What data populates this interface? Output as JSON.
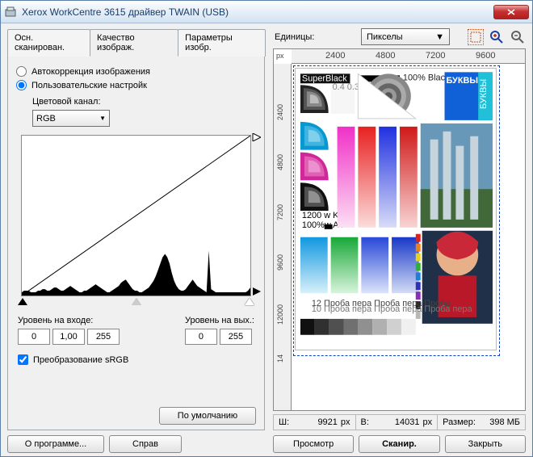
{
  "window": {
    "title": "Xerox WorkCentre 3615 драйвер TWAIN (USB)"
  },
  "tabs": {
    "t0": "Осн. сканирован.",
    "t1": "Качество изображ.",
    "t2": "Параметры изобр."
  },
  "correction": {
    "auto": "Автокоррекция изображения",
    "custom": "Пользовательские настройк",
    "channel_label": "Цветовой канал:",
    "channel_value": "RGB"
  },
  "levels": {
    "in_label": "Уровень на входе:",
    "out_label": "Уровень на вых.:",
    "in_low": "0",
    "in_gamma": "1,00",
    "in_high": "255",
    "out_low": "0",
    "out_high": "255"
  },
  "srgb": {
    "label": "Преобразование sRGB"
  },
  "buttons": {
    "defaults": "По умолчанию",
    "about": "О программе...",
    "help": "Справ",
    "preview": "Просмотр",
    "scan": "Сканир.",
    "close": "Закрыть"
  },
  "units": {
    "label": "Единицы:",
    "value": "Пикселы"
  },
  "ruler": {
    "px": "px",
    "h2400": "2400",
    "h4800": "4800",
    "h7200": "7200",
    "h9600": "9600",
    "v2400": "2400",
    "v4800": "4800",
    "v7200": "7200",
    "v9600": "9600",
    "v12000": "12000",
    "v14": "14"
  },
  "status": {
    "w_label": "Ш:",
    "w_val": "9921",
    "w_unit": "px",
    "h_label": "В:",
    "h_val": "14031",
    "h_unit": "px",
    "size_label": "Размер:",
    "size_val": "398 МБ"
  },
  "histogram": [
    2,
    3,
    3,
    3,
    2,
    2,
    2,
    3,
    3,
    4,
    4,
    3,
    3,
    4,
    5,
    5,
    4,
    3,
    3,
    4,
    5,
    6,
    5,
    4,
    3,
    2,
    2,
    3,
    3,
    4,
    5,
    6,
    7,
    6,
    5,
    4,
    3,
    2,
    2,
    3,
    4,
    5,
    6,
    8,
    9,
    10,
    8,
    6,
    4,
    3,
    3,
    2,
    2,
    3,
    4,
    5,
    7,
    9,
    12,
    16,
    20,
    24,
    26,
    24,
    20,
    14,
    9,
    6,
    4,
    3,
    3,
    4,
    6,
    8,
    10,
    8,
    6,
    5,
    4,
    3,
    2,
    28,
    4,
    3,
    2,
    2,
    2,
    2,
    2,
    2,
    2,
    2,
    2,
    2,
    2,
    2,
    2,
    2,
    3,
    5
  ]
}
